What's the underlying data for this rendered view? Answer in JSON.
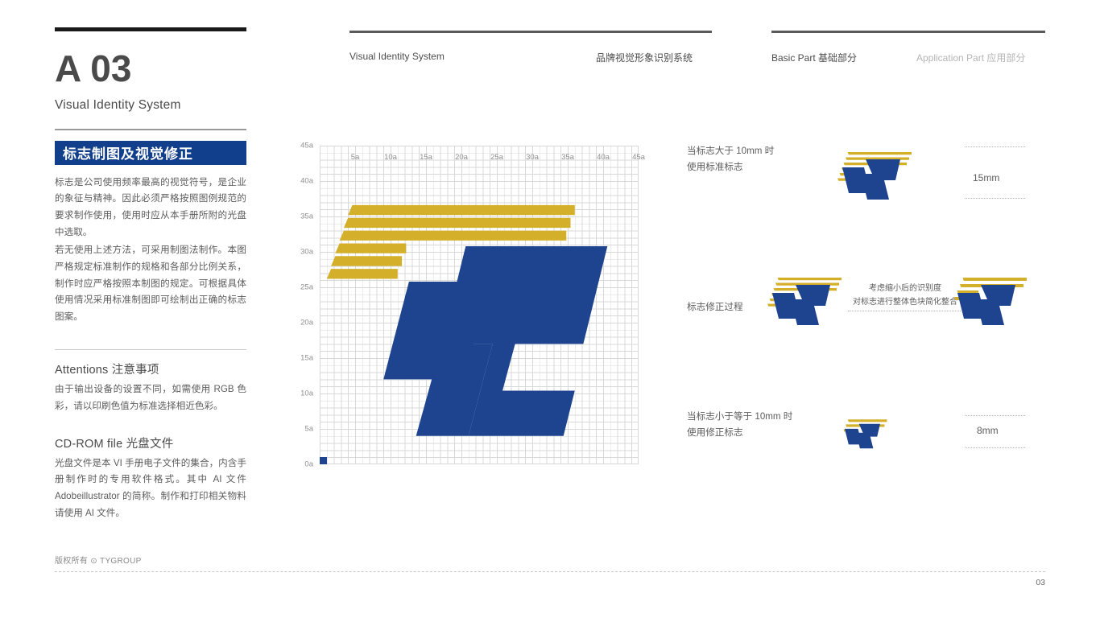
{
  "colors": {
    "brand_blue": "#1e4490",
    "banner_blue": "#123f8c",
    "brand_gold": "#d4af2a",
    "rule_dark": "#1a1a1a",
    "text_gray": "#5d5d5d",
    "muted_gray": "#b5b5b5"
  },
  "left": {
    "page_code": "A 03",
    "page_subtitle": "Visual Identity System",
    "banner_title": "标志制图及视觉修正",
    "paragraph_1": "标志是公司使用频率最高的视觉符号，是企业的象征与精神。因此必须严格按照图例规范的要求制作使用，使用时应从本手册所附的光盘中选取。",
    "paragraph_2": "若无使用上述方法，可采用制图法制作。本图严格规定标准制作的规格和各部分比例关系，制作时应严格按照本制图的规定。可根据具体使用情况采用标准制图即可绘制出正确的标志图案。",
    "attentions_title": "Attentions 注意事项",
    "attentions_body": "由于输出设备的设置不同，如需使用 RGB 色彩，请以印刷色值为标准选择相近色彩。",
    "cdrom_title": "CD-ROM file 光盘文件",
    "cdrom_body": "光盘文件是本 VI 手册电子文件的集合，内含手册制作时的专用软件格式。其中 AI 文件 Adobeillustrator 的简称。制作和打印相关物料请使用 AI 文件。"
  },
  "header": {
    "nav_1": "Visual Identity System",
    "nav_2": "品牌视觉形象识别系统",
    "nav_3": "Basic Part 基础部分",
    "nav_4": "Application Part 应用部分"
  },
  "footer": {
    "copyright": "版权所有 ⊙ TYGROUP",
    "page_number": "03"
  },
  "chart_data": {
    "type": "grid-construction-diagram",
    "title": "标志制图 logo construction grid",
    "unit_label": "a",
    "grid_columns": 45,
    "grid_rows": 45,
    "xlabel": "",
    "ylabel": "",
    "xlim": [
      0,
      45
    ],
    "ylim": [
      0,
      45
    ],
    "x_ticks": [
      "5a",
      "10a",
      "15a",
      "20a",
      "25a",
      "30a",
      "35a",
      "40a",
      "45a"
    ],
    "x_tick_values": [
      5,
      10,
      15,
      20,
      25,
      30,
      35,
      40,
      45
    ],
    "y_ticks": [
      "0a",
      "5a",
      "10a",
      "15a",
      "20a",
      "25a",
      "30a",
      "35a",
      "40a",
      "45a"
    ],
    "y_tick_values": [
      0,
      5,
      10,
      15,
      20,
      25,
      30,
      35,
      40,
      45
    ],
    "grid": true,
    "legend": "none",
    "origin_marker": {
      "x": 0,
      "y": 0,
      "size_a": 1,
      "color": "#1e4490"
    },
    "gold_bars": [
      {
        "name": "bar-long-1",
        "x_left": 4.0,
        "x_right": 36.0,
        "y_bottom": 35.2,
        "y_top": 36.6
      },
      {
        "name": "bar-long-2",
        "x_left": 3.4,
        "x_right": 35.4,
        "y_bottom": 33.4,
        "y_top": 34.8
      },
      {
        "name": "bar-long-3",
        "x_left": 2.8,
        "x_right": 34.8,
        "y_bottom": 31.6,
        "y_top": 33.0
      },
      {
        "name": "bar-short-4",
        "x_left": 2.2,
        "x_right": 12.2,
        "y_bottom": 29.8,
        "y_top": 31.2
      },
      {
        "name": "bar-short-5",
        "x_left": 1.6,
        "x_right": 11.6,
        "y_bottom": 28.0,
        "y_top": 29.4
      },
      {
        "name": "bar-short-6",
        "x_left": 1.0,
        "x_right": 11.0,
        "y_bottom": 26.2,
        "y_top": 27.6
      }
    ],
    "blue_shapes": [
      {
        "name": "left-slab",
        "points_a": [
          [
            9.0,
            12.0
          ],
          [
            12.6,
            25.8
          ],
          [
            24.0,
            25.8
          ],
          [
            20.4,
            12.0
          ]
        ]
      },
      {
        "name": "right-stem-and-bar",
        "points_a": [
          [
            13.6,
            7.2
          ],
          [
            17.2,
            20.8
          ],
          [
            28.6,
            20.8
          ],
          [
            25.8,
            10.4
          ],
          [
            36.0,
            10.4
          ],
          [
            34.4,
            4.0
          ],
          [
            21.0,
            4.0
          ],
          [
            24.4,
            17.0
          ],
          [
            17.0,
            17.0
          ]
        ]
      }
    ]
  },
  "right_panels": [
    {
      "name": "large-usage",
      "label": "当标志大于 10mm 时\n使用标准标志",
      "logo_variant": "standard",
      "dimension": "15mm"
    },
    {
      "name": "correction-process",
      "label": "标志修正过程",
      "note": "考虑缩小后的识别度\n对标志进行整体色块简化整合",
      "logo_variant_from": "standard",
      "logo_variant_to": "simplified"
    },
    {
      "name": "small-usage",
      "label": "当标志小于等于 10mm 时\n使用修正标志",
      "logo_variant": "simplified",
      "dimension": "8mm"
    }
  ]
}
